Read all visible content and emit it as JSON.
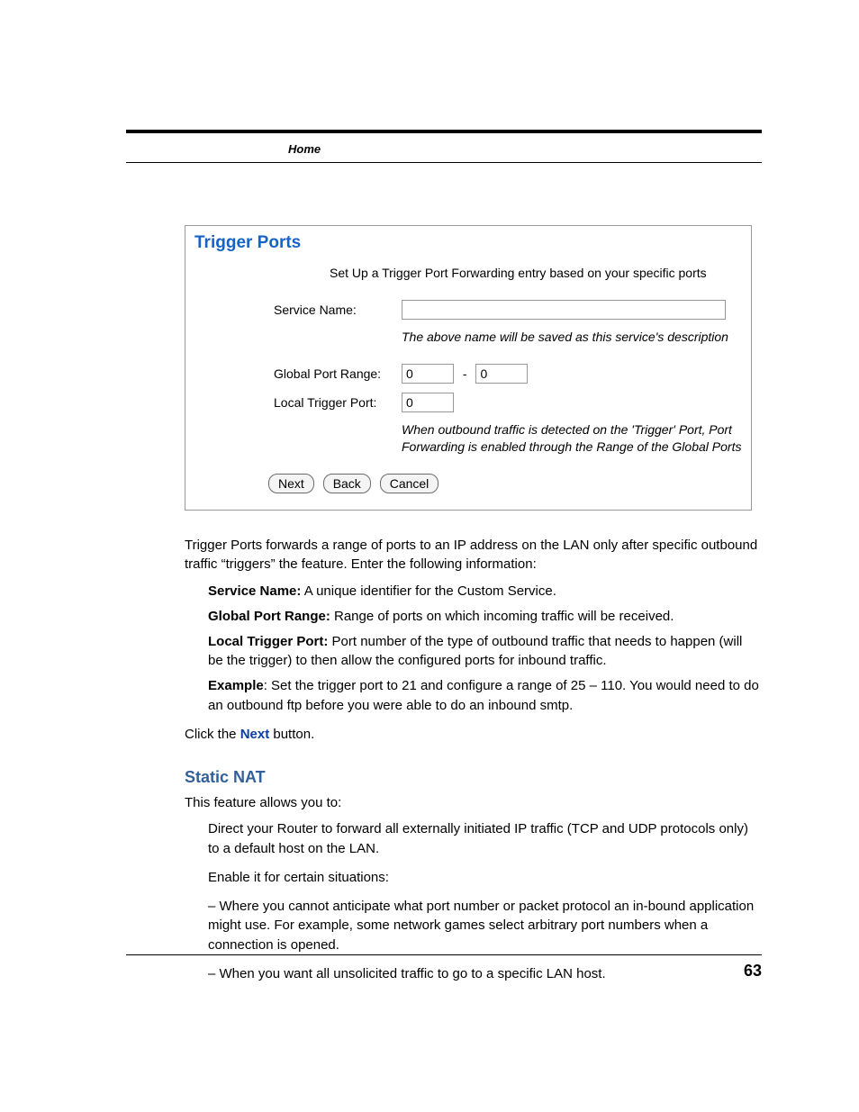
{
  "breadcrumb": "Home",
  "panel": {
    "title": "Trigger Ports",
    "subtitle": "Set Up a Trigger Port Forwarding entry based on your specific ports",
    "service_name_label": "Service Name:",
    "service_name_value": "",
    "service_name_hint": "The above name will be saved as this service's description",
    "global_port_range_label": "Global Port Range:",
    "global_port_from": "0",
    "range_sep": "-",
    "global_port_to": "0",
    "local_trigger_port_label": "Local Trigger Port:",
    "local_trigger_port_value": "0",
    "trigger_hint": "When outbound traffic is detected on the 'Trigger' Port, Port Forwarding is enabled through the Range of the Global Ports",
    "buttons": {
      "next": "Next",
      "back": "Back",
      "cancel": "Cancel"
    }
  },
  "body": {
    "intro": "Trigger Ports forwards a range of ports to an IP address on the LAN only after specific outbound traffic “triggers” the feature. Enter the following information:",
    "defs": {
      "service_name_b": "Service Name:",
      "service_name_t": " A unique identifier for the Custom Service.",
      "global_port_b": "Global Port Range:",
      "global_port_t": " Range of ports on which incoming traffic will be received.",
      "local_trigger_b": "Local Trigger Port:",
      "local_trigger_t": " Port number of the type of outbound traffic that needs to happen (will be the trigger) to then allow the configured ports for inbound traffic.",
      "example_b": "Example",
      "example_t": ": Set the trigger port to 21 and configure a range of 25 – 110. You would need to do an outbound ftp before you were able to do an inbound smtp."
    },
    "click_pre": "Click the ",
    "click_link": "Next",
    "click_post": " button.",
    "section_heading": "Static NAT",
    "section_intro": "This feature allows you to:",
    "bullets": {
      "b1": "Direct your Router to forward all externally initiated IP traffic (TCP and UDP protocols only) to a default host on the LAN.",
      "b2": " Enable it for certain situations:",
      "b3": "– Where you cannot anticipate what port number or packet protocol an in-bound application might use. For example, some network games select arbitrary port numbers when a connection is opened.",
      "b4": "– When you want all unsolicited traffic to go to a specific LAN host."
    }
  },
  "page_number": "63"
}
